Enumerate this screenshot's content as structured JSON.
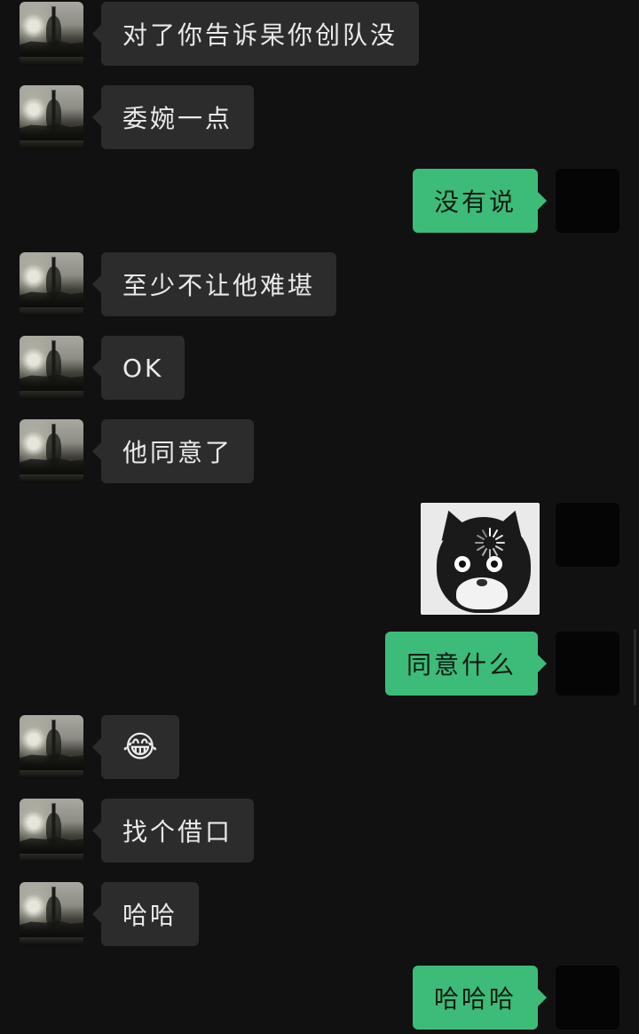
{
  "messages": [
    {
      "side": "left",
      "text": "对了你告诉杲你创队没"
    },
    {
      "side": "left",
      "text": "委婉一点"
    },
    {
      "side": "right",
      "text": "没有说"
    },
    {
      "side": "left",
      "text": "至少不让他难堪"
    },
    {
      "side": "left",
      "text": "OK"
    },
    {
      "side": "left",
      "text": "他同意了"
    },
    {
      "side": "right",
      "sticker": "cat-loading-spinner"
    },
    {
      "side": "right",
      "text": "同意什么"
    },
    {
      "side": "left",
      "emoji": "😂"
    },
    {
      "side": "left",
      "text": "找个借口"
    },
    {
      "side": "left",
      "text": "哈哈"
    },
    {
      "side": "right",
      "text": "哈哈哈"
    }
  ],
  "theme": {
    "background": "#111111",
    "incoming_bubble": "#2c2c2c",
    "outgoing_bubble": "#3dbb78"
  }
}
